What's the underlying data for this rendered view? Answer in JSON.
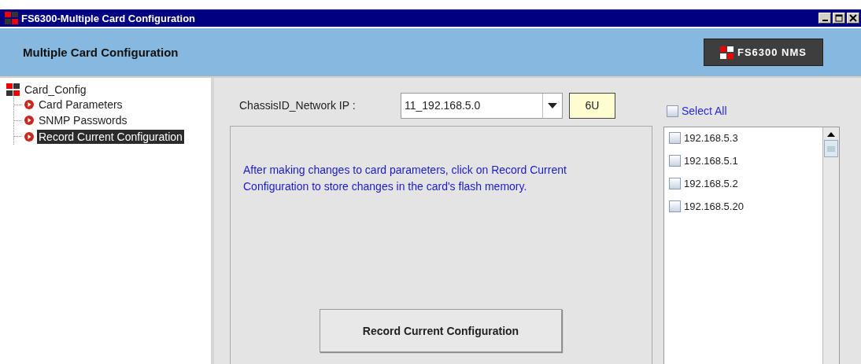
{
  "window": {
    "title": "FS6300-Multiple Card Configuration"
  },
  "header": {
    "title": "Multiple Card Configuration",
    "logo_text": "FS6300 NMS"
  },
  "tree": [
    {
      "label": "Card_Config",
      "expanded": true,
      "selected": false,
      "children": [
        {
          "label": "Card Parameters",
          "selected": false
        },
        {
          "label": "SNMP Passwords",
          "selected": false
        },
        {
          "label": "Record Current Configuration",
          "selected": true
        }
      ]
    }
  ],
  "chassis": {
    "label": "ChassisID_Network IP :",
    "value": "11_192.168.5.0",
    "unit": "6U"
  },
  "info_text": "After making changes to card parameters, click on Record Current Configuration to store changes in the card's flash memory.",
  "record_button": "Record Current Configuration",
  "select_all": {
    "label": "Select All",
    "checked": false
  },
  "ip_list": [
    {
      "label": "192.168.5.3",
      "checked": false
    },
    {
      "label": "192.168.5.1",
      "checked": false
    },
    {
      "label": "192.168.5.2",
      "checked": false
    },
    {
      "label": "192.168.5.20",
      "checked": false
    }
  ]
}
